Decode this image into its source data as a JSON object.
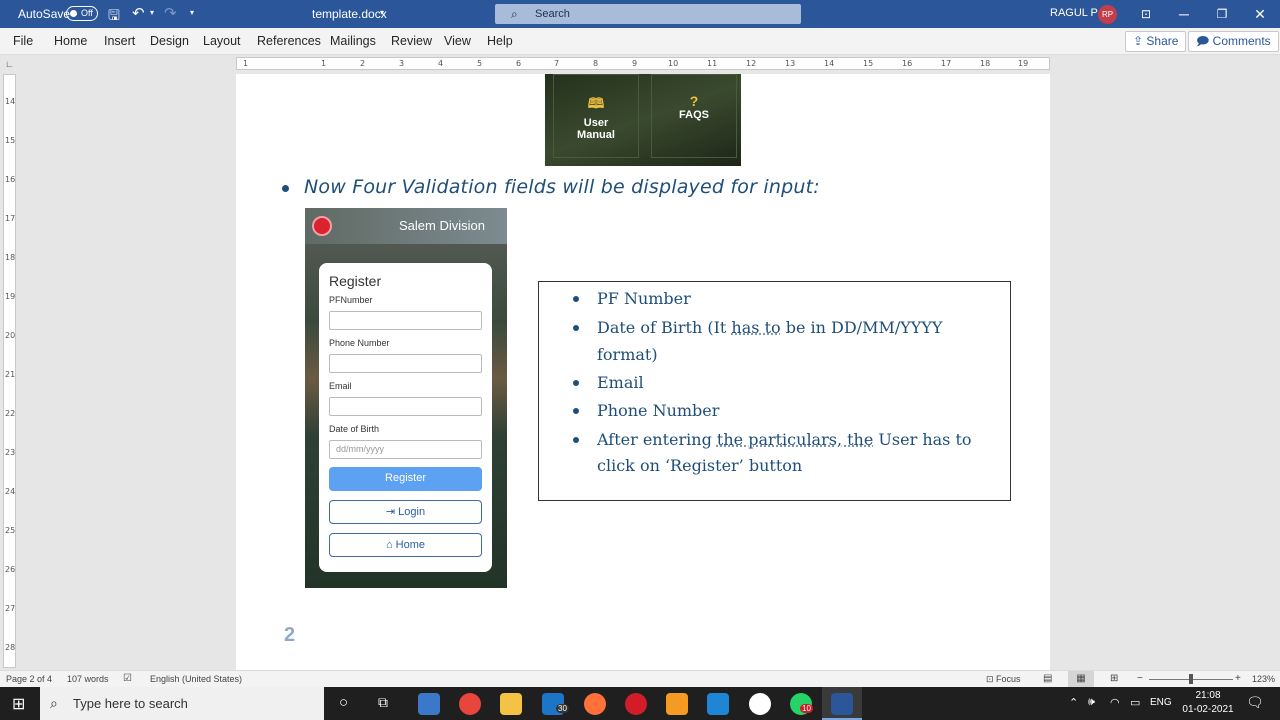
{
  "titlebar": {
    "autosave_label": "AutoSave",
    "autosave_state": "Off",
    "filename": "template.docx",
    "search_placeholder": "Search",
    "user_name": "RAGUL P",
    "user_initials": "RP"
  },
  "menu": {
    "items": [
      "File",
      "Home",
      "Insert",
      "Design",
      "Layout",
      "References",
      "Mailings",
      "Review",
      "View",
      "Help"
    ],
    "share": "Share",
    "comments": "Comments"
  },
  "rulers": {
    "horizontal": [
      "1",
      "1",
      "2",
      "3",
      "4",
      "5",
      "6",
      "7",
      "8",
      "9",
      "10",
      "11",
      "12",
      "13",
      "14",
      "15",
      "16",
      "17",
      "18",
      "19"
    ],
    "vertical": [
      "14",
      "15",
      "16",
      "17",
      "18",
      "19",
      "20",
      "21",
      "22",
      "23",
      "24",
      "25",
      "26",
      "27",
      "28"
    ]
  },
  "document": {
    "tiles": [
      {
        "icon": "book-icon",
        "label_line1": "User",
        "label_line2": "Manual"
      },
      {
        "icon": "question-icon",
        "label_line1": "FAQS",
        "label_line2": ""
      }
    ],
    "heading": "Now Four Validation fields will be displayed for input:",
    "phone": {
      "header_title": "Salem Division",
      "form_title": "Register",
      "fields": [
        {
          "label": "PFNumber",
          "placeholder": ""
        },
        {
          "label": "Phone Number",
          "placeholder": ""
        },
        {
          "label": "Email",
          "placeholder": ""
        },
        {
          "label": "Date of Birth",
          "placeholder": "dd/mm/yyyy"
        }
      ],
      "register_button": "Register",
      "login_button": "Login",
      "home_button": "Home"
    },
    "bullets": {
      "pf": "PF Number",
      "dob_a": "Date of Birth (It ",
      "dob_b": "has to",
      "dob_c": " be in DD/MM/YYYY",
      "dob_d": "format)",
      "email": "Email",
      "phone": "Phone Number",
      "after_a": "After entering ",
      "after_b": "the particulars, the",
      "after_c": " User has to",
      "after_d": "click on ‘Register’ button"
    },
    "page_number": "2"
  },
  "statusbar": {
    "page": "Page 2 of 4",
    "words": "107 words",
    "language": "English (United States)",
    "focus": "Focus",
    "zoom": "123%"
  },
  "taskbar": {
    "search_placeholder": "Type here to search",
    "mail_badge": "30",
    "whatsapp_badge": "10",
    "language": "ENG",
    "time": "21:08",
    "date": "01-02-2021"
  }
}
